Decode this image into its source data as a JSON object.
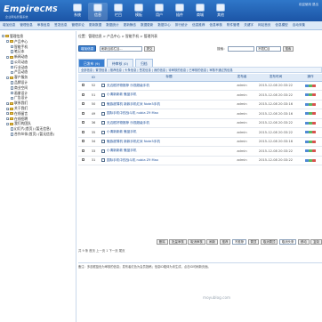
{
  "header": {
    "logo_main": "Empire",
    "logo_sub": "CMS",
    "logo_tagline": "企业网站管理系统",
    "nav": [
      {
        "label": "系统",
        "icon": "gear-icon"
      },
      {
        "label": "信息",
        "icon": "info-icon"
      },
      {
        "label": "栏目",
        "icon": "column-icon"
      },
      {
        "label": "模板",
        "icon": "template-icon"
      },
      {
        "label": "用户",
        "icon": "user-icon"
      },
      {
        "label": "插件",
        "icon": "plugin-icon"
      },
      {
        "label": "商城",
        "icon": "shop-icon"
      },
      {
        "label": "其他",
        "icon": "more-icon"
      }
    ],
    "right_text": "欢迎使用 退出"
  },
  "subnav": [
    "增加信息",
    "管理信息",
    "审核信息",
    "签发信息",
    "管理评论",
    "更新数据",
    "数据统计",
    "更新静态",
    "数据更新",
    "数据中心",
    "排行统计",
    "信息推荐",
    "信息审核",
    "附件管理",
    "关键字",
    "网站首页",
    "信息模型",
    "自动采集"
  ],
  "sidebar": {
    "items": [
      {
        "label": "管理信息",
        "indent": 0,
        "kind": "folder",
        "toggle": "-"
      },
      {
        "label": "产品中心",
        "indent": 1,
        "kind": "folder",
        "toggle": "-"
      },
      {
        "label": "智能手机",
        "indent": 2,
        "kind": "doc"
      },
      {
        "label": "笔记本",
        "indent": 2,
        "kind": "doc"
      },
      {
        "label": "新闻动态",
        "indent": 1,
        "kind": "folder",
        "toggle": "-"
      },
      {
        "label": "公司动态",
        "indent": 2,
        "kind": "doc"
      },
      {
        "label": "行业动态",
        "indent": 2,
        "kind": "doc"
      },
      {
        "label": "产品动态",
        "indent": 2,
        "kind": "doc"
      },
      {
        "label": "客户服务",
        "indent": 1,
        "kind": "folder",
        "toggle": "-"
      },
      {
        "label": "品牌设计",
        "indent": 2,
        "kind": "doc"
      },
      {
        "label": "商业空间",
        "indent": 2,
        "kind": "doc"
      },
      {
        "label": "画册设计",
        "indent": 2,
        "kind": "doc"
      },
      {
        "label": "广告设计",
        "indent": 2,
        "kind": "doc"
      },
      {
        "label": "联系我们",
        "indent": 1,
        "kind": "folder",
        "toggle": "+"
      },
      {
        "label": "关于我们",
        "indent": 1,
        "kind": "folder",
        "toggle": "+"
      },
      {
        "label": "在线留言",
        "indent": 1,
        "kind": "folder",
        "toggle": "+"
      },
      {
        "label": "在线招聘",
        "indent": 1,
        "kind": "folder",
        "toggle": "+"
      },
      {
        "label": "我们的团队",
        "indent": 1,
        "kind": "folder",
        "toggle": "-"
      },
      {
        "label": "幻灯片(首页) (暂无信息)",
        "indent": 2,
        "kind": "doc"
      },
      {
        "label": "合作伙伴(首页) (暂无信息)",
        "indent": 2,
        "kind": "doc"
      }
    ]
  },
  "main": {
    "breadcrumb": "位置：管理信息 > 产品中心 > 智能手机 > 管理列表",
    "add_button": "增加信息",
    "refresh_select": "刷新当前栏目...",
    "refresh_button": "提交",
    "search_label": "搜索：",
    "search_select": "不限栏目",
    "search_button": "搜索",
    "tabs": [
      "已发布 (9)",
      "待审核 (0)",
      "归档"
    ],
    "filter_text": "全部信息 | 置顶信息 | 推荐信息 | 头条信息 | 签发信息 | 我的信息 | 待审核的信息 | 已审核的信息 | 审核不通过的信息",
    "columns": [
      "",
      "ID",
      "",
      "标题",
      "发布者",
      "发布时间",
      "操作"
    ],
    "rows": [
      {
        "id": "52",
        "title": "无边框好物推荐 乐视超级手机",
        "publisher": "admin",
        "time": "2015-12-08 20:33:22"
      },
      {
        "id": "51",
        "title": "小清新新款 魅蓝手机",
        "publisher": "admin",
        "time": "2015-12-08 20:33:22"
      },
      {
        "id": "50",
        "title": "魅族超薄机 新款手机红米 Note3手机",
        "publisher": "admin",
        "time": "2015-12-08 20:33:16"
      },
      {
        "id": "49",
        "title": "国际手机中的战斗机 nubia Z9 Max",
        "publisher": "admin",
        "time": "2015-12-08 20:33:16"
      },
      {
        "id": "36",
        "title": "无边框好物推荐 乐视超级手机",
        "publisher": "admin",
        "time": "2015-12-08 20:33:22"
      },
      {
        "id": "35",
        "title": "小清新新款 魅蓝手机",
        "publisher": "admin",
        "time": "2015-12-08 20:33:22"
      },
      {
        "id": "34",
        "title": "魅族超薄机 新款手机红米 Note3手机",
        "publisher": "admin",
        "time": "2015-12-08 20:33:16"
      },
      {
        "id": "33",
        "title": "小清新新款 魅蓝手机",
        "publisher": "admin",
        "time": "2015-12-08 20:33:22"
      },
      {
        "id": "31",
        "title": "国际手机中的战斗机 nubia Z9 Max",
        "publisher": "admin",
        "time": "2015-12-08 20:33:22"
      }
    ],
    "actions": [
      "删除",
      "批量审核",
      "取消审核",
      "刷新",
      "推荐",
      "不推荐",
      "置顶",
      "取消置顶",
      "头条",
      "移动",
      "复制"
    ],
    "action_select": "不推荐",
    "action_select2": "取消头条",
    "pager": "共 9 条  首页  上一页  1  下一页  尾页",
    "note": "备注：多选框蓝色为审核的信息；发布者红色为会员投稿；信息ID粗体为未生成，点击ID可刷新页面。"
  },
  "watermark": "moyublog.com",
  "colors": {
    "header": "#1c55a6",
    "accent": "#3a7fd1",
    "sidebar_folder": "#e8c64c"
  }
}
